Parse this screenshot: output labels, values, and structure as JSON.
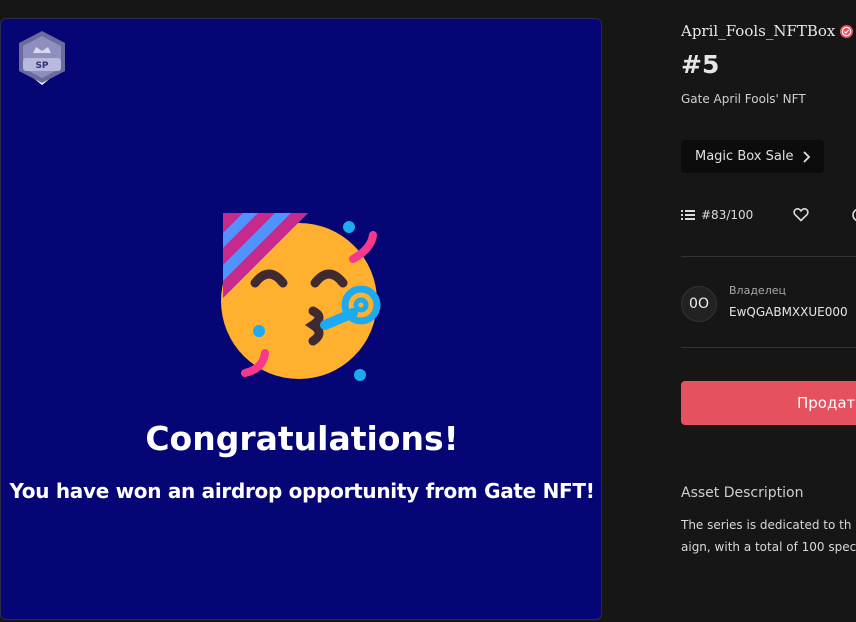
{
  "artwork": {
    "badge_label": "SP",
    "title": "Congratulations!",
    "subtitle": "You have won an airdrop opportunity from Gate NFT!",
    "background": "#050575"
  },
  "details": {
    "collection_name": "April_Fools_NFTBox",
    "token_number": "#5",
    "nft_name": "Gate April Fools' NFT",
    "magic_box_button": "Magic Box Sale",
    "edition": "#83/100"
  },
  "owner": {
    "avatar_text": "0O",
    "label": "Владелец",
    "value": "EwQGABMXXUE000"
  },
  "actions": {
    "sell_button": "Продат"
  },
  "description": {
    "title": "Asset Description",
    "line1": "The series is dedicated to th",
    "line2": "aign, with a total of 100 spec"
  },
  "colors": {
    "accent": "#e5515f",
    "verified": "#e5515f",
    "page_bg": "#161616"
  }
}
